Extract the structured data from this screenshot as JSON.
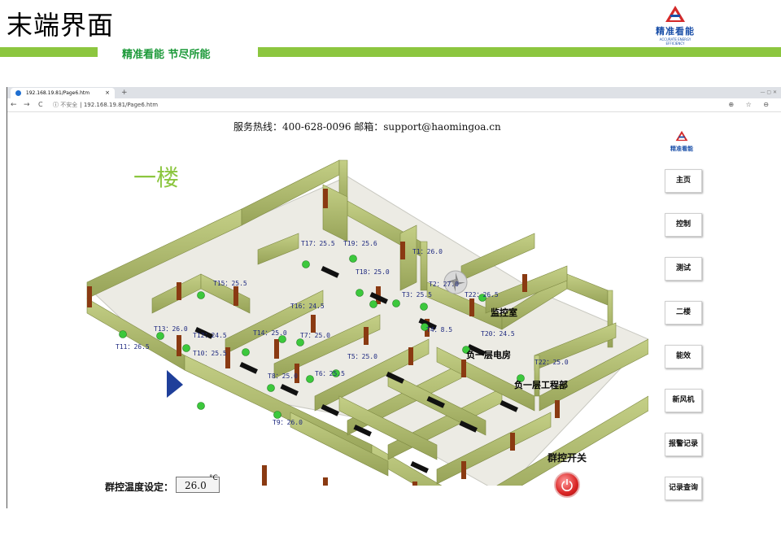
{
  "slide": {
    "title": "末端界面",
    "slogan": "精准看能 节尽所能",
    "brand_name": "精准看能",
    "brand_sub": "ACCURATE ENERGY EFFICIENCY"
  },
  "browser": {
    "tab_title": "192.168.19.81/Page6.htm",
    "tab_close": "×",
    "new_tab": "+",
    "security": "不安全",
    "url": "192.168.19.81/Page6.htm",
    "back": "←",
    "forward": "→",
    "reload": "C",
    "info": "ⓘ",
    "right_icons": "⊕ ☆ ⊖"
  },
  "page": {
    "hotline": "服务热线：400-628-0096 邮箱：support@haomingoa.cn",
    "floor_title": "一楼",
    "logo_text": "精准看能",
    "temp_label": "群控温度设定：",
    "temp_value": "26.0",
    "temp_unit": "°C",
    "group_switch_label": "群控开关"
  },
  "menu": [
    {
      "label": "主页"
    },
    {
      "label": "控制"
    },
    {
      "label": "测试"
    },
    {
      "label": "二楼"
    },
    {
      "label": "能效"
    },
    {
      "label": "新风机"
    },
    {
      "label": "报警记录"
    },
    {
      "label": "记录查询"
    }
  ],
  "sensors": [
    {
      "label": "T1：26.0"
    },
    {
      "label": "T2：27.0"
    },
    {
      "label": "T3：25.5"
    },
    {
      "label": "T4：8.5"
    },
    {
      "label": "T5：25.0"
    },
    {
      "label": "T6：25.5"
    },
    {
      "label": "T7：25.0"
    },
    {
      "label": "T8：25.0"
    },
    {
      "label": "T9：26.0"
    },
    {
      "label": "T10：25.5"
    },
    {
      "label": "T11：26.5"
    },
    {
      "label": "T12：24.5"
    },
    {
      "label": "T13：26.0"
    },
    {
      "label": "T14：25.0"
    },
    {
      "label": "T15：25.5"
    },
    {
      "label": "T16：24.5"
    },
    {
      "label": "T17：25.5"
    },
    {
      "label": "T18：25.0"
    },
    {
      "label": "T19：25.6"
    },
    {
      "label": "T20：24.5"
    },
    {
      "label": "T22：26.5"
    },
    {
      "label": "T22：25.0"
    }
  ],
  "rooms": [
    {
      "label": "监控室"
    },
    {
      "label": "负一层电房"
    },
    {
      "label": "负一层工程部"
    }
  ],
  "colors": {
    "accent_green": "#8cc63f",
    "wall": "#a9b56a",
    "sensor_dot": "#3cc83c",
    "sensor_text": "#1f2a80",
    "brand_blue": "#1a4fa8",
    "power_red": "#d92424"
  }
}
